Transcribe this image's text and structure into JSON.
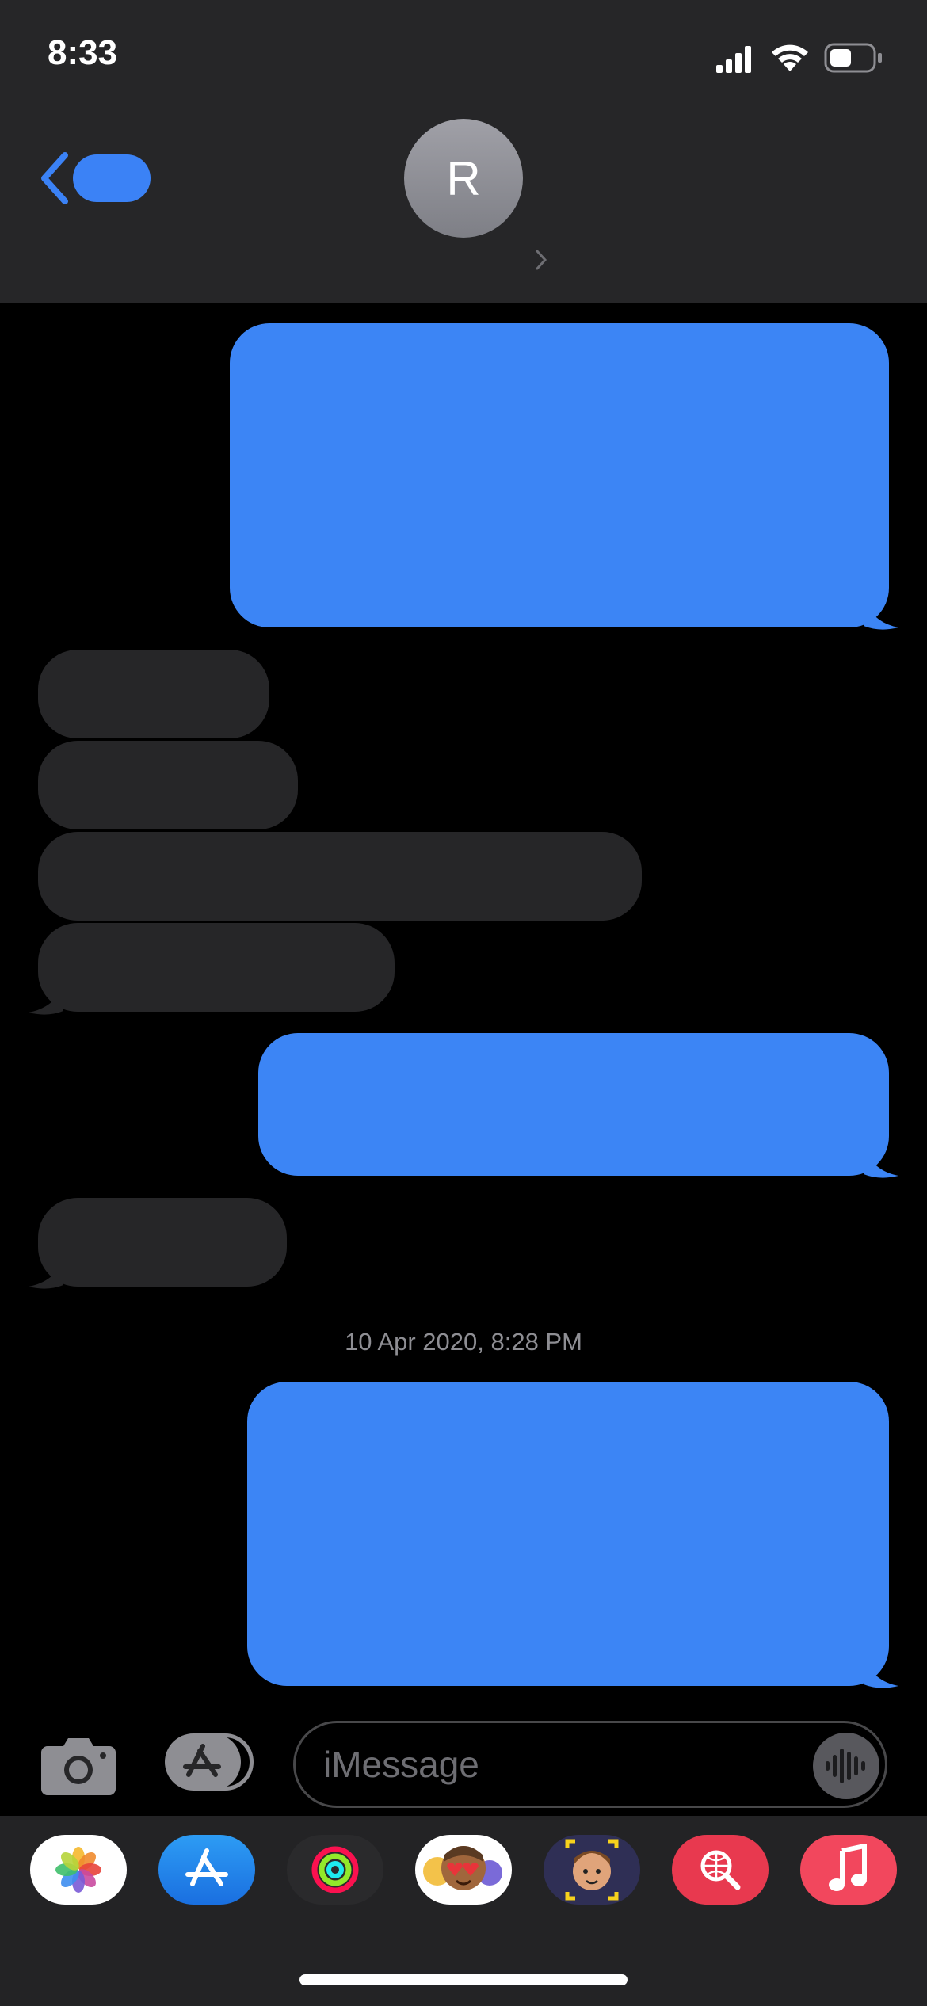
{
  "status_bar": {
    "time": "8:33"
  },
  "header": {
    "avatar_initial": "R"
  },
  "conversation": {
    "timestamp": "10 Apr 2020, 8:28 PM"
  },
  "input_bar": {
    "placeholder": "iMessage"
  },
  "app_strip": {
    "apps": [
      "photos-app-icon",
      "app-store-app-icon",
      "activity-app-icon",
      "memoji-stickers-app-icon",
      "animoji-app-icon",
      "web-images-search-app-icon",
      "music-app-icon"
    ]
  },
  "colors": {
    "sent_bubble": "#3c85f5",
    "received_bubble": "#262628",
    "accent": "#3b82f6",
    "background": "#000000"
  }
}
